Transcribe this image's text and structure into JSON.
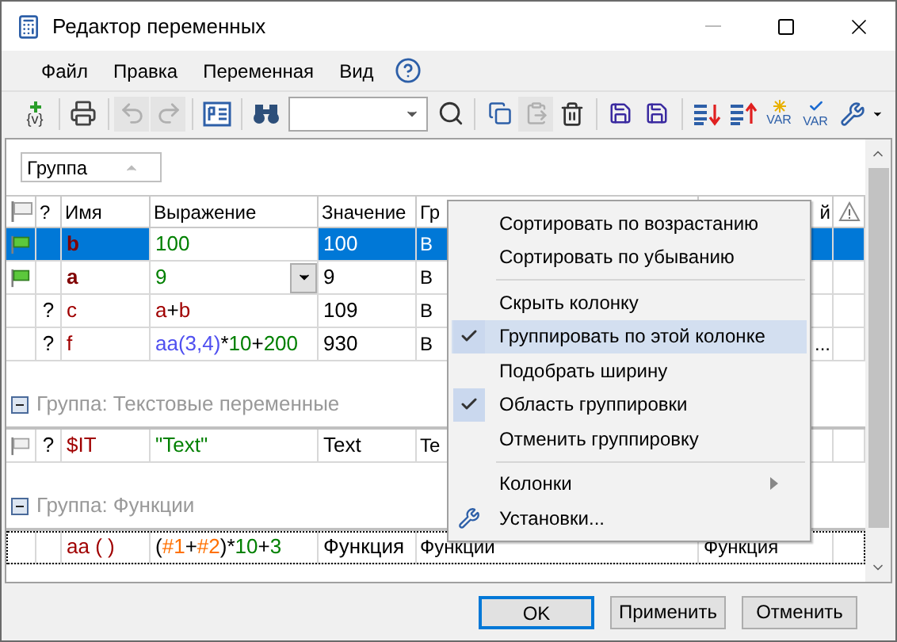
{
  "window": {
    "title": "Редактор переменных"
  },
  "menu": [
    "Файл",
    "Правка",
    "Переменная",
    "Вид"
  ],
  "toolbar": [
    {
      "kind": "add",
      "label": "{v}",
      "disabled": false
    },
    {
      "kind": "sep"
    },
    {
      "kind": "print",
      "disabled": false
    },
    {
      "kind": "sep"
    },
    {
      "kind": "undo",
      "disabled": true
    },
    {
      "kind": "redo",
      "disabled": true
    },
    {
      "kind": "sep"
    },
    {
      "kind": "page",
      "disabled": false
    },
    {
      "kind": "sep"
    },
    {
      "kind": "find",
      "disabled": false
    },
    {
      "kind": "combo"
    },
    {
      "kind": "search",
      "disabled": false
    },
    {
      "kind": "sep"
    },
    {
      "kind": "copy",
      "disabled": false
    },
    {
      "kind": "paste",
      "disabled": true
    },
    {
      "kind": "delete",
      "disabled": false
    },
    {
      "kind": "sep"
    },
    {
      "kind": "save-up",
      "disabled": false
    },
    {
      "kind": "save-down",
      "disabled": false
    },
    {
      "kind": "sep"
    },
    {
      "kind": "sort-down",
      "disabled": false
    },
    {
      "kind": "sort-up",
      "disabled": false
    },
    {
      "kind": "new-var",
      "label": "VAR",
      "disabled": false
    },
    {
      "kind": "check-var",
      "label": "VAR",
      "disabled": false
    },
    {
      "kind": "settings",
      "disabled": false
    }
  ],
  "group_panel": {
    "chip": "Группа"
  },
  "table": {
    "columns": [
      {
        "kind": "flag"
      },
      {
        "kind": "text",
        "label": "?"
      },
      {
        "kind": "text",
        "label": "Имя"
      },
      {
        "kind": "text",
        "label": "Выражение"
      },
      {
        "kind": "text",
        "label": "Значение"
      },
      {
        "kind": "text",
        "label": "Гр"
      },
      {
        "kind": "end",
        "label": "й"
      },
      {
        "kind": "warning"
      }
    ],
    "sections": [
      {
        "rows": [
          {
            "flag": true,
            "q": "",
            "name": "b",
            "bold": true,
            "expr": [
              {
                "kind": "num",
                "text": "100"
              }
            ],
            "value": "100",
            "group": "В",
            "last": "",
            "selected": true,
            "editing": false,
            "focused": false
          },
          {
            "flag": true,
            "q": "",
            "name": "a",
            "bold": true,
            "expr": [
              {
                "kind": "num",
                "text": "9"
              }
            ],
            "value": "9",
            "group": "В",
            "last": "",
            "selected": false,
            "editing": true,
            "focused": false
          },
          {
            "flag": false,
            "q": "?",
            "name": "c",
            "bold": false,
            "expr": [
              {
                "kind": "var",
                "text": "a"
              },
              {
                "kind": "op",
                "text": "+"
              },
              {
                "kind": "var",
                "text": "b"
              }
            ],
            "value": "109",
            "group": "В",
            "last": "",
            "selected": false,
            "editing": false,
            "focused": false
          },
          {
            "flag": false,
            "q": "?",
            "name": "f",
            "bold": false,
            "expr": [
              {
                "kind": "func",
                "text": "aa(3,4)"
              },
              {
                "kind": "op",
                "text": "*"
              },
              {
                "kind": "num",
                "text": "10"
              },
              {
                "kind": "op",
                "text": "+"
              },
              {
                "kind": "num",
                "text": "200"
              }
            ],
            "value": "930",
            "group": "В",
            "last_cut": "...",
            "selected": false,
            "editing": false,
            "focused": false
          }
        ]
      },
      {
        "header": "Группа: Текстовые переменные",
        "expanded": true,
        "rows": [
          {
            "flag": false,
            "q": "?",
            "name": "$IT",
            "bold": false,
            "expr": [
              {
                "kind": "string",
                "text": "\"Text\""
              }
            ],
            "value": "Text",
            "group": "Te",
            "last": "",
            "selected": false,
            "editing": false,
            "focused": false,
            "empty_flag": true
          }
        ]
      },
      {
        "header": "Группа: Функции",
        "expanded": true,
        "rows": [
          {
            "flag": false,
            "q": "",
            "name": "aa ( )",
            "bold": false,
            "expr": [
              {
                "kind": "op",
                "text": "("
              },
              {
                "kind": "param",
                "text": "#1"
              },
              {
                "kind": "op",
                "text": "+"
              },
              {
                "kind": "param",
                "text": "#2"
              },
              {
                "kind": "op",
                "text": ")*"
              },
              {
                "kind": "num",
                "text": "10"
              },
              {
                "kind": "op",
                "text": "+"
              },
              {
                "kind": "num",
                "text": "3"
              }
            ],
            "value": "Функция",
            "group": "Функции",
            "last": "Функция",
            "selected": false,
            "editing": false,
            "focused": true
          }
        ]
      }
    ]
  },
  "context_menu": [
    {
      "kind": "item",
      "label": "Сортировать по возрастанию",
      "checked": false,
      "highlighted": false
    },
    {
      "kind": "item",
      "label": "Сортировать по убыванию",
      "checked": false,
      "highlighted": false
    },
    {
      "kind": "separator"
    },
    {
      "kind": "item",
      "label": "Скрыть колонку",
      "checked": false,
      "highlighted": false
    },
    {
      "kind": "item",
      "label": "Группировать по этой колонке",
      "checked": true,
      "highlighted": true
    },
    {
      "kind": "item",
      "label": "Подобрать ширину",
      "checked": false,
      "highlighted": false
    },
    {
      "kind": "item",
      "label": "Область группировки",
      "checked": true,
      "highlighted": false
    },
    {
      "kind": "item",
      "label": "Отменить группировку",
      "checked": false,
      "highlighted": false
    },
    {
      "kind": "separator"
    },
    {
      "kind": "submenu",
      "label": "Колонки",
      "checked": false,
      "highlighted": false
    },
    {
      "kind": "settings",
      "label": "Установки...",
      "checked": false,
      "highlighted": false
    }
  ],
  "buttons": [
    {
      "label": "OK",
      "default": true
    },
    {
      "label": "Применить",
      "default": false
    },
    {
      "label": "Отменить",
      "default": false
    }
  ]
}
